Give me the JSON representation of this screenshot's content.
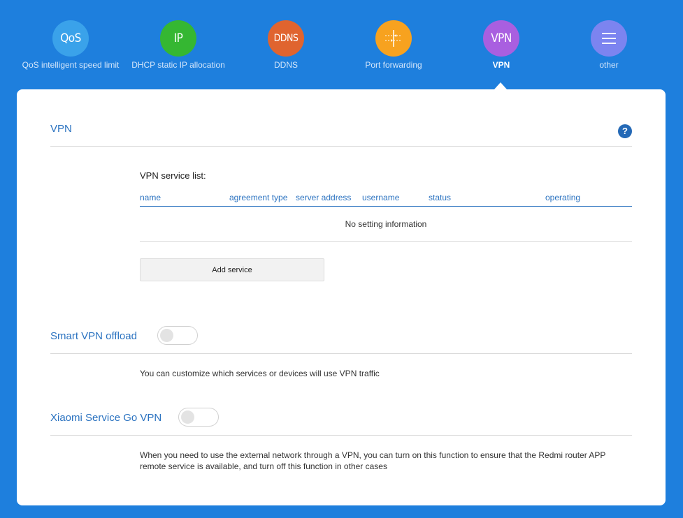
{
  "nav": {
    "items": [
      {
        "icon_text": "QoS",
        "label": "QoS intelligent speed limit",
        "color": "#3aa2ea",
        "icon": "qos-icon"
      },
      {
        "icon_text": "IP",
        "label": "DHCP static IP allocation",
        "color": "#35b732",
        "icon": "ip-icon"
      },
      {
        "icon_text": "DDNS",
        "label": "DDNS",
        "color": "#e0642f",
        "icon": "ddns-icon"
      },
      {
        "icon_text": "",
        "label": "Port forwarding",
        "color": "#f7a21f",
        "icon": "port-forwarding-icon"
      },
      {
        "icon_text": "VPN",
        "label": "VPN",
        "color": "#a95fe0",
        "icon": "vpn-icon",
        "active": true
      },
      {
        "icon_text": "",
        "label": "other",
        "color": "#7c84f0",
        "icon": "menu-icon"
      }
    ]
  },
  "vpn": {
    "title": "VPN",
    "help": "?",
    "list_title": "VPN service list:",
    "columns": [
      "name",
      "agreement type",
      "server address",
      "username",
      "status",
      "operating"
    ],
    "empty_message": "No setting information",
    "add_button": "Add service"
  },
  "smart_offload": {
    "title": "Smart VPN offload",
    "enabled": false,
    "description": "You can customize which services or devices will use VPN traffic"
  },
  "xiaomi_go": {
    "title": "Xiaomi Service Go VPN",
    "enabled": false,
    "description": "When you need to use the external network through a VPN, you can turn on this function to ensure that the Redmi router APP remote service is available, and turn off this function in other cases"
  },
  "colors": {
    "background": "#1e7fdd",
    "accent": "#2a72c0"
  }
}
